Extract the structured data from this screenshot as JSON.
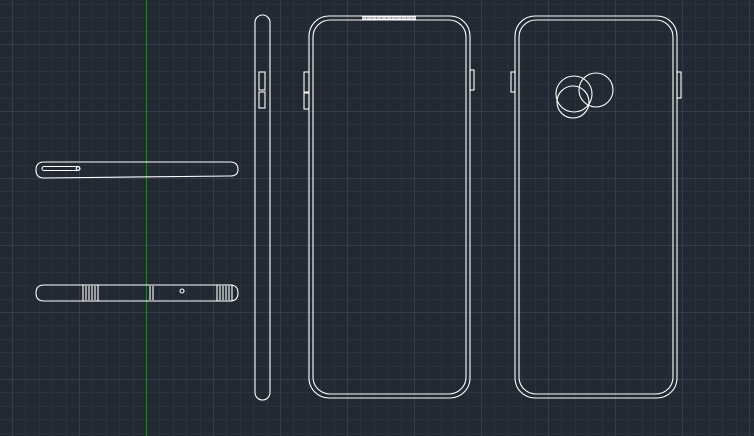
{
  "viewport": {
    "background": "#222932",
    "grid_minor_color": "#2a323c",
    "grid_major_color": "#343d49",
    "ucs_y_axis_color": "#2f7a3a",
    "linework_color": "#ffffff"
  },
  "drawing": {
    "objects": [
      "phone-top-edge-view",
      "phone-bottom-edge-view",
      "phone-side-profile-view",
      "phone-front-view",
      "phone-back-view"
    ]
  }
}
